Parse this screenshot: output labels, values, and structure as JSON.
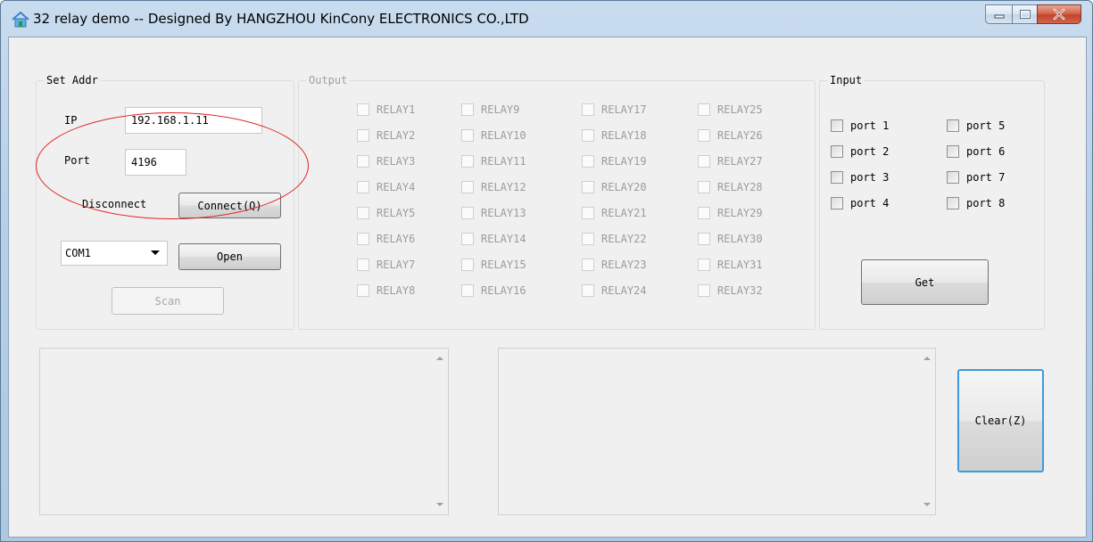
{
  "window": {
    "title": "32 relay demo -- Designed By HANGZHOU KinCony ELECTRONICS CO.,LTD"
  },
  "set_addr": {
    "legend": "Set Addr",
    "ip_label": "IP",
    "ip_value": "192.168.1.11",
    "port_label": "Port",
    "port_value": "4196",
    "status": "Disconnect",
    "connect_label": "Connect(Q)",
    "com_value": "COM1",
    "open_label": "Open",
    "scan_label": "Scan"
  },
  "output": {
    "legend": "Output",
    "relays": [
      "RELAY1",
      "RELAY2",
      "RELAY3",
      "RELAY4",
      "RELAY5",
      "RELAY6",
      "RELAY7",
      "RELAY8",
      "RELAY9",
      "RELAY10",
      "RELAY11",
      "RELAY12",
      "RELAY13",
      "RELAY14",
      "RELAY15",
      "RELAY16",
      "RELAY17",
      "RELAY18",
      "RELAY19",
      "RELAY20",
      "RELAY21",
      "RELAY22",
      "RELAY23",
      "RELAY24",
      "RELAY25",
      "RELAY26",
      "RELAY27",
      "RELAY28",
      "RELAY29",
      "RELAY30",
      "RELAY31",
      "RELAY32"
    ]
  },
  "input": {
    "legend": "Input",
    "ports": [
      "port 1",
      "port 2",
      "port 3",
      "port 4",
      "port 5",
      "port 6",
      "port 7",
      "port 8"
    ],
    "get_label": "Get"
  },
  "log": {
    "clear_label": "Clear(Z)"
  },
  "colors": {
    "annotation": "#e02020",
    "title_gradient": "#b7cfe7",
    "close_button": "#c2442a"
  },
  "icons": [
    "home-icon",
    "minimize-icon",
    "maximize-icon",
    "close-icon",
    "dropdown-arrow-icon",
    "scroll-up-icon",
    "scroll-down-icon"
  ]
}
